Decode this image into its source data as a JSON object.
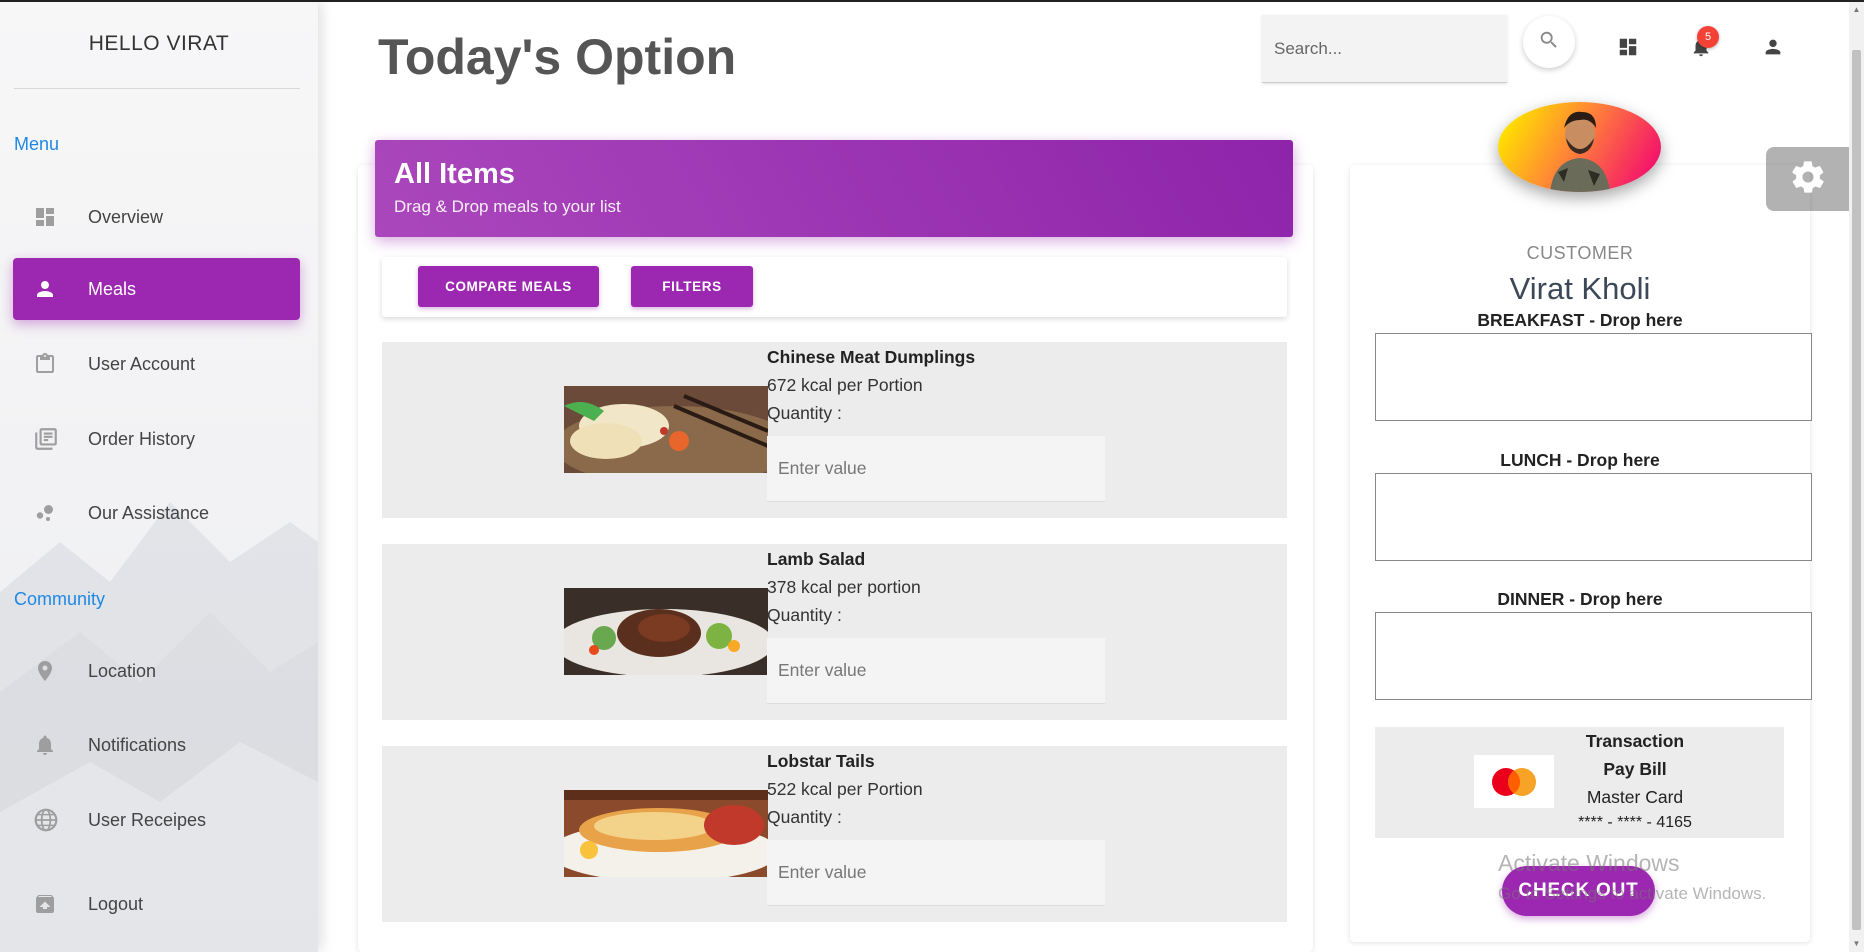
{
  "sidebar": {
    "greeting": "HELLO VIRAT",
    "menu_label": "Menu",
    "community_label": "Community",
    "menu_items": [
      {
        "label": "Overview",
        "icon": "dashboard-icon"
      },
      {
        "label": "Meals",
        "icon": "person-icon",
        "active": true
      },
      {
        "label": "User Account",
        "icon": "clipboard-icon"
      },
      {
        "label": "Order History",
        "icon": "library-books-icon"
      },
      {
        "label": "Our Assistance",
        "icon": "bubble-chart-icon"
      }
    ],
    "community_items": [
      {
        "label": "Location",
        "icon": "location-pin-icon"
      },
      {
        "label": "Notifications",
        "icon": "bell-icon"
      },
      {
        "label": "User Receipes",
        "icon": "globe-icon"
      },
      {
        "label": "Logout",
        "icon": "unarchive-icon"
      }
    ]
  },
  "header": {
    "title": "Today's Option",
    "search_placeholder": "Search...",
    "notification_count": "5"
  },
  "all_items": {
    "title": "All Items",
    "subtitle": "Drag & Drop meals to your list",
    "compare_label": "COMPARE MEALS",
    "filters_label": "FILTERS"
  },
  "meals": [
    {
      "name": "Chinese Meat Dumplings",
      "kcal": "672 kcal per Portion",
      "qty_label": "Quantity :",
      "placeholder": "Enter value"
    },
    {
      "name": "Lamb Salad",
      "kcal": "378 kcal per portion",
      "qty_label": "Quantity :",
      "placeholder": "Enter value"
    },
    {
      "name": "Lobstar Tails",
      "kcal": "522 kcal per Portion",
      "qty_label": "Quantity :",
      "placeholder": "Enter value"
    }
  ],
  "customer": {
    "role": "CUSTOMER",
    "name": "Virat Kholi",
    "breakfast_label": "BREAKFAST - Drop here",
    "lunch_label": "LUNCH - Drop here",
    "dinner_label": "DINNER - Drop here",
    "transaction": {
      "title": "Transaction",
      "pay_bill": "Pay Bill",
      "card_type": "Master Card",
      "card_number": "**** - **** - 4165"
    },
    "checkout_label": "CHECK OUT"
  },
  "watermark": {
    "line1": "Activate Windows",
    "line2": "Go to Settings to activate Windows."
  },
  "colors": {
    "accent": "#9c27b0",
    "link": "#1e88e5",
    "badge": "#f44336"
  }
}
